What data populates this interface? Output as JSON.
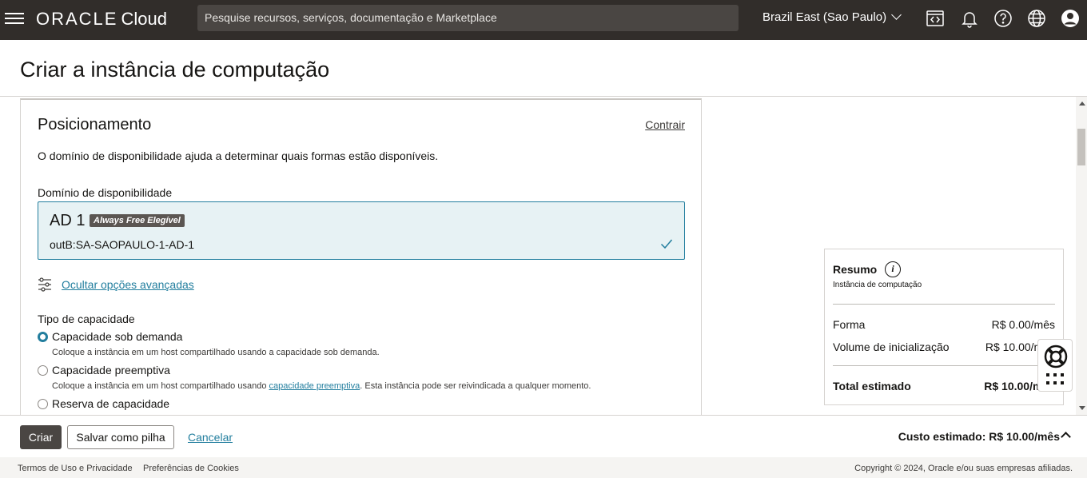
{
  "header": {
    "logo_oracle": "ORACLE",
    "logo_cloud": "Cloud",
    "search_placeholder": "Pesquise recursos, serviços, documentação e Marketplace",
    "region": "Brazil East (Sao Paulo)"
  },
  "page": {
    "title": "Criar a instância de computação"
  },
  "placement": {
    "title": "Posicionamento",
    "collapse_label": "Contrair",
    "description": "O domínio de disponibilidade ajuda a determinar quais formas estão disponíveis.",
    "ad_label": "Domínio de disponibilidade",
    "ad_name": "AD 1",
    "ad_badge": "Always Free Elegível",
    "ad_sub": "outB:SA-SAOPAULO-1-AD-1",
    "advanced_link": "Ocultar opções avançadas",
    "capacity_label": "Tipo de capacidade",
    "options": [
      {
        "label": "Capacidade sob demanda",
        "help": "Coloque a instância em um host compartilhado usando a capacidade sob demanda.",
        "selected": true
      },
      {
        "label": "Capacidade preemptiva",
        "help_pre": "Coloque a instância em um host compartilhado usando ",
        "help_link": "capacidade preemptiva",
        "help_post": ". Esta instância pode ser reivindicada a qualquer momento.",
        "selected": false
      },
      {
        "label": "Reserva de capacidade",
        "selected": false
      }
    ]
  },
  "summary": {
    "title": "Resumo",
    "subtitle": "Instância de computação",
    "rows": [
      {
        "label": "Forma",
        "value": "R$ 0.00/mês"
      },
      {
        "label": "Volume de inicialização",
        "value": "R$ 10.00/mês"
      }
    ],
    "total_label": "Total estimado",
    "total_value": "R$ 10.00/mês"
  },
  "actions": {
    "create": "Criar",
    "save_stack": "Salvar como pilha",
    "cancel": "Cancelar",
    "cost": "Custo estimado: R$ 10.00/mês"
  },
  "footer": {
    "terms": "Termos de Uso e Privacidade",
    "cookies": "Preferências de Cookies",
    "copyright": "Copyright © 2024, Oracle e/ou suas empresas afiliadas."
  },
  "icons": [
    "hamburger-icon",
    "code-editor-icon",
    "bell-icon",
    "help-icon",
    "globe-icon",
    "user-icon",
    "check-icon",
    "sliders-icon",
    "info-icon",
    "lifebuoy-icon",
    "apps-grid-icon",
    "chevron-up-icon"
  ],
  "colors": {
    "header_bg": "#312d2a",
    "accent": "#227e9e",
    "selected_bg": "#e7f2f4",
    "primary_button": "#4a4643"
  }
}
